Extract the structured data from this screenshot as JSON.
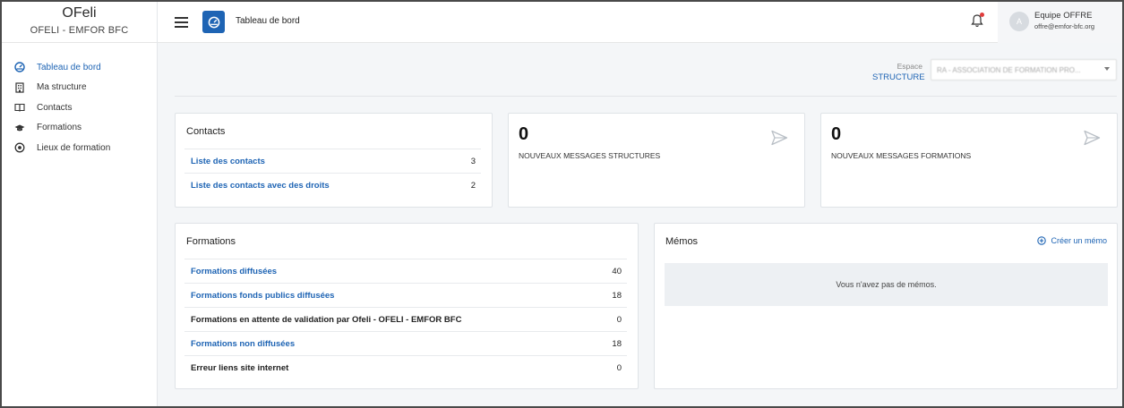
{
  "sidebar": {
    "brand_title": "OFeli",
    "brand_subtitle": "OFELI - EMFOR BFC",
    "items": [
      {
        "label": "Tableau de bord",
        "icon": "dashboard-icon",
        "active": true
      },
      {
        "label": "Ma structure",
        "icon": "building-icon",
        "active": false
      },
      {
        "label": "Contacts",
        "icon": "address-book-icon",
        "active": false
      },
      {
        "label": "Formations",
        "icon": "graduation-cap-icon",
        "active": false
      },
      {
        "label": "Lieux de formation",
        "icon": "location-target-icon",
        "active": false
      }
    ]
  },
  "header": {
    "page_title": "Tableau de bord",
    "user_initial": "A",
    "user_name": "Equipe OFFRE",
    "user_email": "offre@emfor-bfc.org"
  },
  "espace": {
    "label": "Espace",
    "value": "STRUCTURE",
    "select_value": "RA - ASSOCIATION DE FORMATION PRO..."
  },
  "contacts_card": {
    "title": "Contacts",
    "rows": [
      {
        "label": "Liste des contacts",
        "count": "3"
      },
      {
        "label": "Liste des contacts avec des droits",
        "count": "2"
      }
    ]
  },
  "messages_structures": {
    "count": "0",
    "label": "NOUVEAUX MESSAGES STRUCTURES"
  },
  "messages_formations": {
    "count": "0",
    "label": "NOUVEAUX MESSAGES FORMATIONS"
  },
  "formations_card": {
    "title": "Formations",
    "rows": [
      {
        "label": "Formations diffusées",
        "count": "40"
      },
      {
        "label": "Formations fonds publics diffusées",
        "count": "18"
      },
      {
        "label": "Formations en attente de validation par Ofeli - OFELI - EMFOR BFC",
        "count": "0"
      },
      {
        "label": "Formations non diffusées",
        "count": "18"
      },
      {
        "label": "Erreur liens site internet",
        "count": "0"
      }
    ]
  },
  "memos_card": {
    "title": "Mémos",
    "create_label": "Créer un mémo",
    "empty_text": "Vous n'avez pas de mémos."
  },
  "colors": {
    "accent": "#1e64b4",
    "notification_dot": "#e03c3c",
    "background": "#f4f6f8"
  }
}
